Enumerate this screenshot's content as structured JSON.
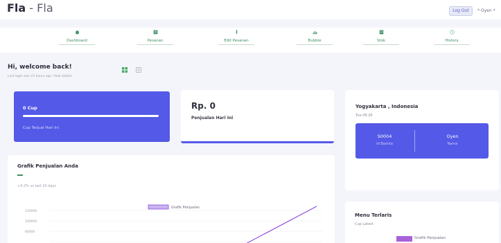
{
  "header": {
    "brand_bold": "Fla",
    "brand_sep": " - ",
    "brand_light": "Fla",
    "logout_label": "Log Out",
    "user_label": "* Oyen *"
  },
  "nav": {
    "items": [
      {
        "label": "Dashboard",
        "icon": "home-icon"
      },
      {
        "label": "Pesanan",
        "icon": "cart-icon"
      },
      {
        "label": "Edit Pesanan",
        "icon": "edit-icon"
      },
      {
        "label": "Bubble",
        "icon": "chart-icon"
      },
      {
        "label": "Stok",
        "icon": "box-icon"
      },
      {
        "label": "History",
        "icon": "history-icon"
      }
    ],
    "icon_color": "#3e8f62"
  },
  "welcome": {
    "title": "Hi, welcome back!",
    "subtitle": "Last login was 23 hours ago. View details"
  },
  "cards": {
    "cup": {
      "title": "0 Cup",
      "subtitle": "Cup Terjual Hari Ini",
      "progress": 1.0
    },
    "sales": {
      "value": "Rp. 0",
      "label": "Penjualan Hari Ini"
    },
    "location": {
      "city": "Yogyakarta , Indonesia",
      "time": "Tue 08:26",
      "barista_id": "S0004",
      "barista_id_label": "Id Barista",
      "name": "Oyen",
      "name_label": "Nama"
    }
  },
  "sales_chart": {
    "title": "Grafik Penjualan Anda",
    "subtitle": "+3.2% vs last 10 days",
    "chart_data": {
      "type": "line",
      "legend": "Grafik Penjualan",
      "ytick_labels": [
        "120000",
        "100000",
        "80000"
      ],
      "series": [
        {
          "name": "Grafik Penjualan",
          "color": "#8a4ee0"
        }
      ]
    }
  },
  "menu_chart": {
    "title": "Menu Terlaris",
    "subtitle": "Cup Latest",
    "legend": "Grafik Penjualan"
  },
  "colors": {
    "accent": "#5459e7",
    "purple": "#a763d8",
    "green": "#3e8f62"
  }
}
